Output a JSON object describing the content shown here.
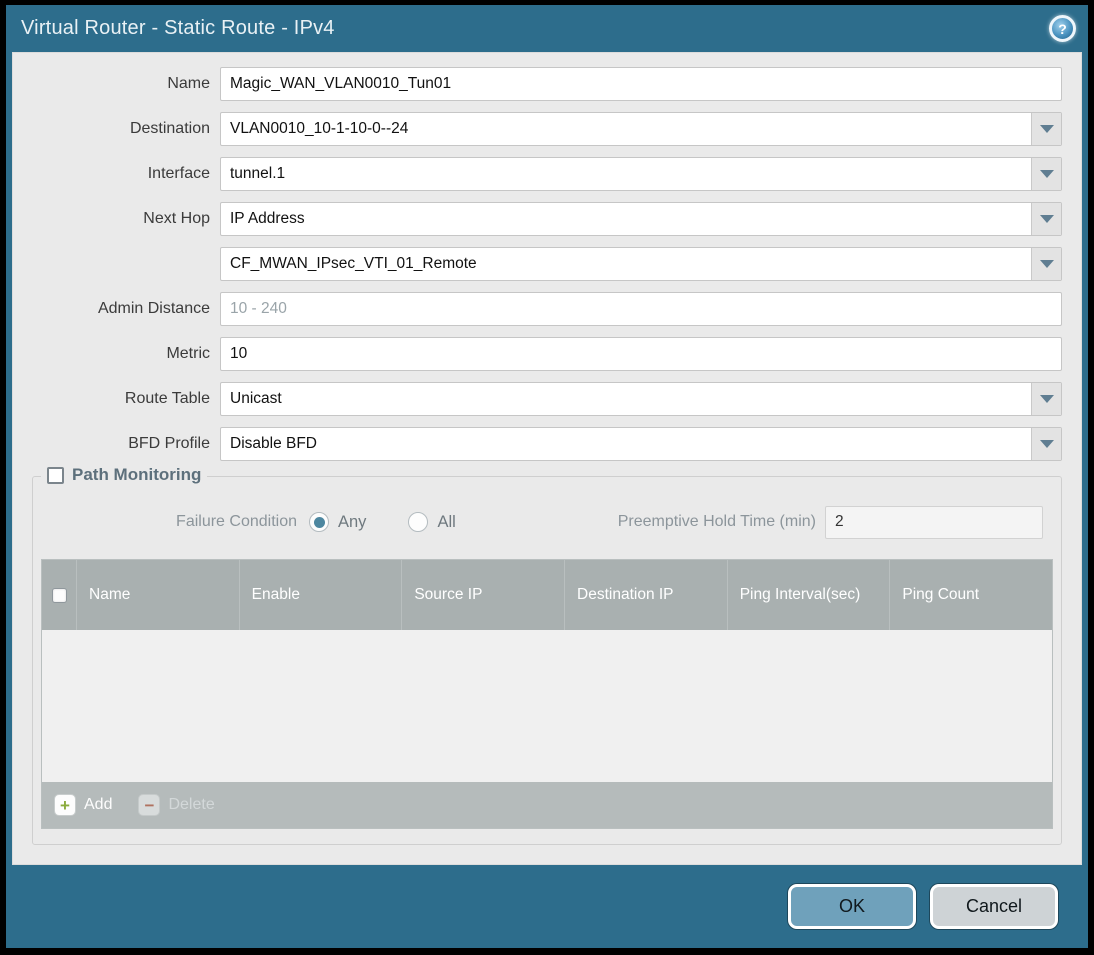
{
  "dialog": {
    "title": "Virtual Router - Static Route - IPv4",
    "help_icon_glyph": "?"
  },
  "form": {
    "fields": [
      {
        "label": "Name",
        "value": "Magic_WAN_VLAN0010_Tun01",
        "type": "text"
      },
      {
        "label": "Destination",
        "value": "VLAN0010_10-1-10-0--24",
        "type": "dropdown"
      },
      {
        "label": "Interface",
        "value": "tunnel.1",
        "type": "dropdown"
      },
      {
        "label": "Next Hop",
        "value": "IP Address",
        "type": "dropdown"
      },
      {
        "label": "",
        "value": "CF_MWAN_IPsec_VTI_01_Remote",
        "type": "dropdown"
      },
      {
        "label": "Admin Distance",
        "value": "",
        "placeholder": "10 - 240",
        "type": "text"
      },
      {
        "label": "Metric",
        "value": "10",
        "type": "text"
      },
      {
        "label": "Route Table",
        "value": "Unicast",
        "type": "dropdown"
      },
      {
        "label": "BFD Profile",
        "value": "Disable BFD",
        "type": "dropdown"
      }
    ]
  },
  "path_monitoring": {
    "legend": "Path Monitoring",
    "checkbox_checked": false,
    "failure_condition": {
      "label": "Failure Condition",
      "options": [
        {
          "label": "Any",
          "selected": true
        },
        {
          "label": "All",
          "selected": false
        }
      ]
    },
    "preemptive_hold_time": {
      "label": "Preemptive Hold Time (min)",
      "value": "2"
    },
    "table": {
      "columns": [
        "Name",
        "Enable",
        "Source IP",
        "Destination IP",
        "Ping Interval(sec)",
        "Ping Count"
      ],
      "rows": []
    },
    "toolbar": {
      "add_label": "Add",
      "delete_label": "Delete"
    }
  },
  "footer": {
    "ok_label": "OK",
    "cancel_label": "Cancel"
  },
  "colors": {
    "titlebar_teal": "#2d6d8c",
    "content_bg": "#eaeaea",
    "table_header_gray": "#a9b0b0",
    "toolbar_gray": "#b5bbbb",
    "ok_button_blue": "#6fa1bb",
    "cancel_button_gray": "#ced3d6",
    "add_icon_green": "#8aab3c",
    "delete_icon_red": "#b07260",
    "radio_selected_teal": "#4d87a0"
  }
}
